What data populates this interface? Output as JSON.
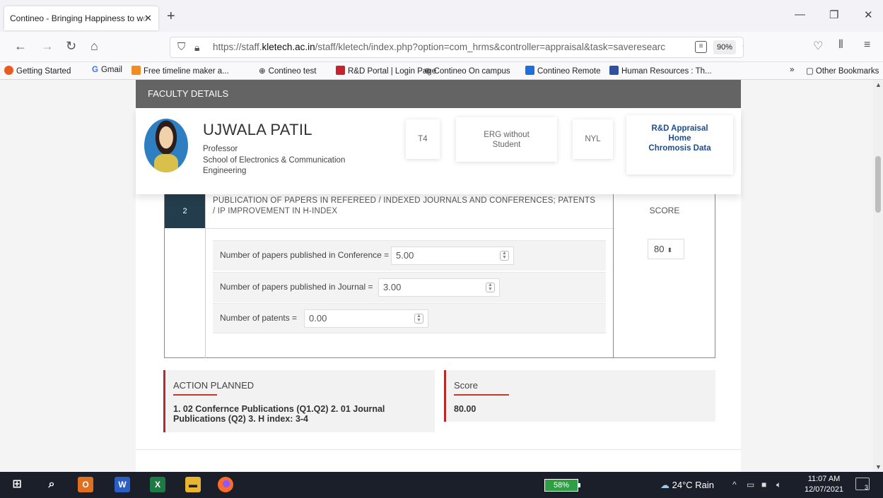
{
  "browser": {
    "tab_title": "Contineo - Bringing Happiness to w",
    "tab_title_fade": "o",
    "url_prefix": "https://staff.",
    "url_domain": "kletech.ac.in",
    "url_rest": "/staff/kletech/index.php?option=com_hrms&controller=appraisal&task=saveresearc",
    "zoom": "90%",
    "bookmarks": [
      {
        "label": "Getting Started",
        "color": "#e85d1f"
      },
      {
        "label": "Gmail",
        "color": "#3b78e7"
      },
      {
        "label": "Free timeline maker a...",
        "color": "#ef8d22"
      },
      {
        "label": "Contineo test",
        "color": "#555555"
      },
      {
        "label": "R&D Portal | Login Page",
        "color": "#c8222c"
      },
      {
        "label": "Contineo On campus",
        "color": "#555555"
      },
      {
        "label": "Contineo Remote",
        "color": "#1e6fd9"
      },
      {
        "label": "Human Resources : Th...",
        "color": "#2f4fa0"
      }
    ],
    "other_bookmarks": "Other Bookmarks"
  },
  "faculty": {
    "header": "FACULTY DETAILS",
    "name": "UJWALA PATIL",
    "designation": "Professor",
    "school_line1": "School of Electronics & Communication",
    "school_line2": "Engineering",
    "badge_grade": "T4",
    "badge_erg_line1": "ERG without",
    "badge_erg_line2": "Student",
    "badge_nyl": "NYL",
    "link_appraisal": "R&D Appraisal",
    "link_home": "Home",
    "link_chromosis": "Chromosis Data"
  },
  "section": {
    "number": "2",
    "title_line1": "PUBLICATION OF PAPERS IN REFEREED / INDEXED JOURNALS AND CONFERENCES; PATENTS",
    "title_line2": "/ IP IMPROVEMENT IN H-INDEX",
    "score_header": "SCORE",
    "score_value": "80",
    "fields": [
      {
        "label": "Number of papers published in Conference =",
        "value": "5.00"
      },
      {
        "label": "Number of papers published in Journal =",
        "value": "3.00"
      },
      {
        "label": "Number of patents =",
        "value": "0.00"
      }
    ]
  },
  "action": {
    "title": "ACTION PLANNED",
    "text_line1": "1. 02 Confernce Publications (Q1.Q2) 2. 01 Journal",
    "text_line2": "Publications (Q2) 3. H index: 3-4"
  },
  "score_box": {
    "title": "Score",
    "value": "80.00"
  },
  "taskbar": {
    "battery": "58%",
    "weather": "24°C Rain",
    "time": "11:07 AM",
    "date": "12/07/2021",
    "notifications": "3"
  }
}
